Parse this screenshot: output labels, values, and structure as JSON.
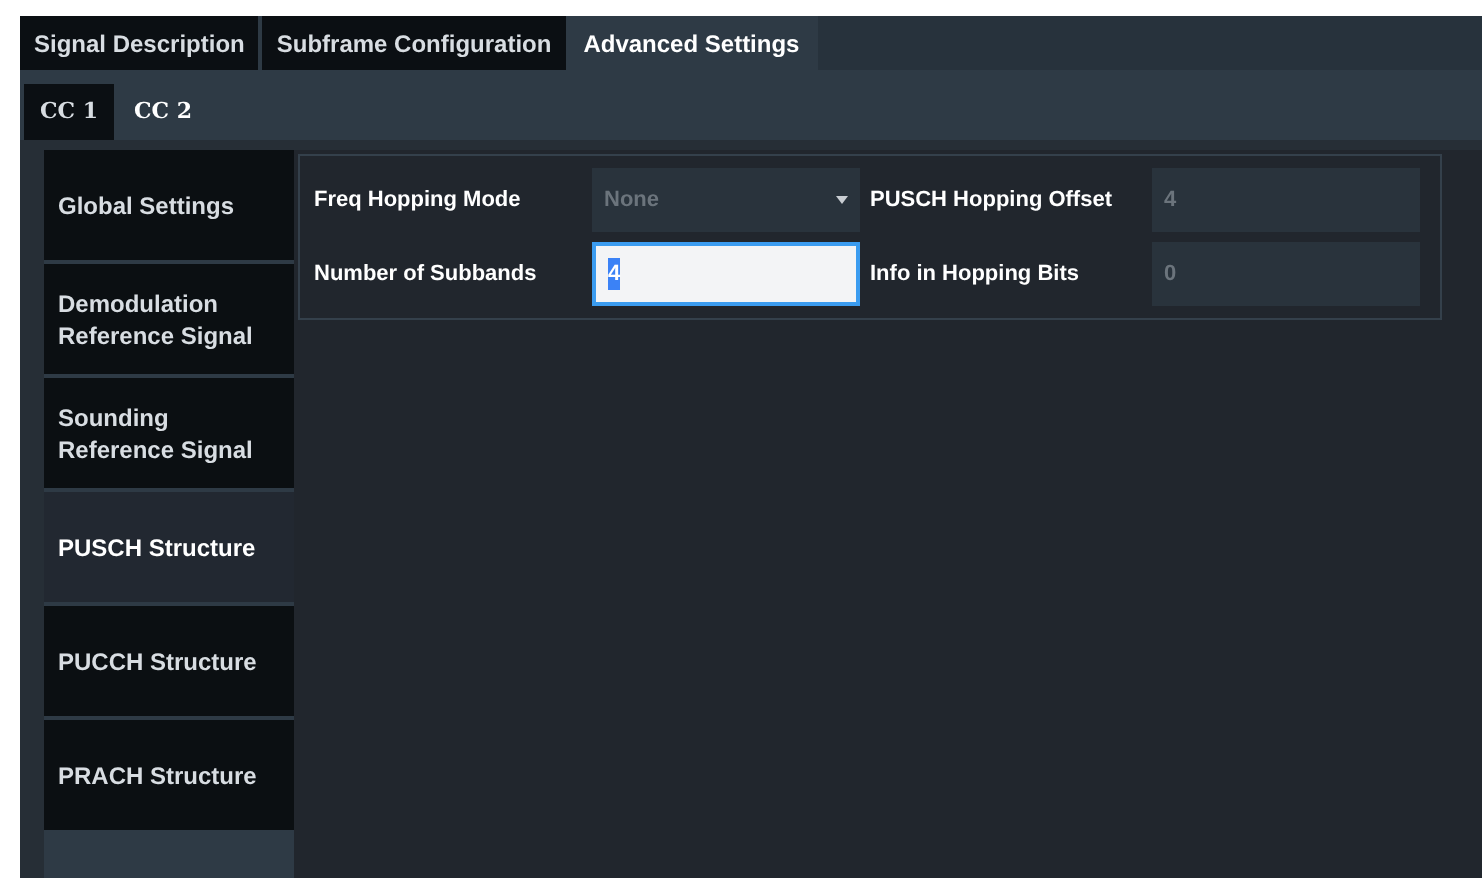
{
  "tabs": [
    {
      "label": "Signal Description",
      "selected": false
    },
    {
      "label": "Subframe Configuration",
      "selected": false
    },
    {
      "label": "Advanced Settings",
      "selected": true
    }
  ],
  "subtabs": [
    {
      "label": "CC 1",
      "selected": false
    },
    {
      "label": "CC 2",
      "selected": true
    }
  ],
  "sidebar": {
    "items": [
      {
        "label": "Global Settings",
        "selected": false
      },
      {
        "label": "Demodulation Reference Signal",
        "selected": false
      },
      {
        "label": "Sounding Reference Signal",
        "selected": false
      },
      {
        "label": "PUSCH Structure",
        "selected": true
      },
      {
        "label": "PUCCH Structure",
        "selected": false
      },
      {
        "label": "PRACH Structure",
        "selected": false
      }
    ]
  },
  "fields": [
    {
      "label": "Freq Hopping Mode",
      "kind": "dropdown",
      "value": "None",
      "disabled": true
    },
    {
      "label": "PUSCH Hopping Offset",
      "kind": "input",
      "value": "4",
      "disabled": true
    },
    {
      "label": "Number of Subbands",
      "kind": "input",
      "value": "4",
      "disabled": false
    },
    {
      "label": "Info in Hopping Bits",
      "kind": "input",
      "value": "0",
      "disabled": true
    }
  ]
}
